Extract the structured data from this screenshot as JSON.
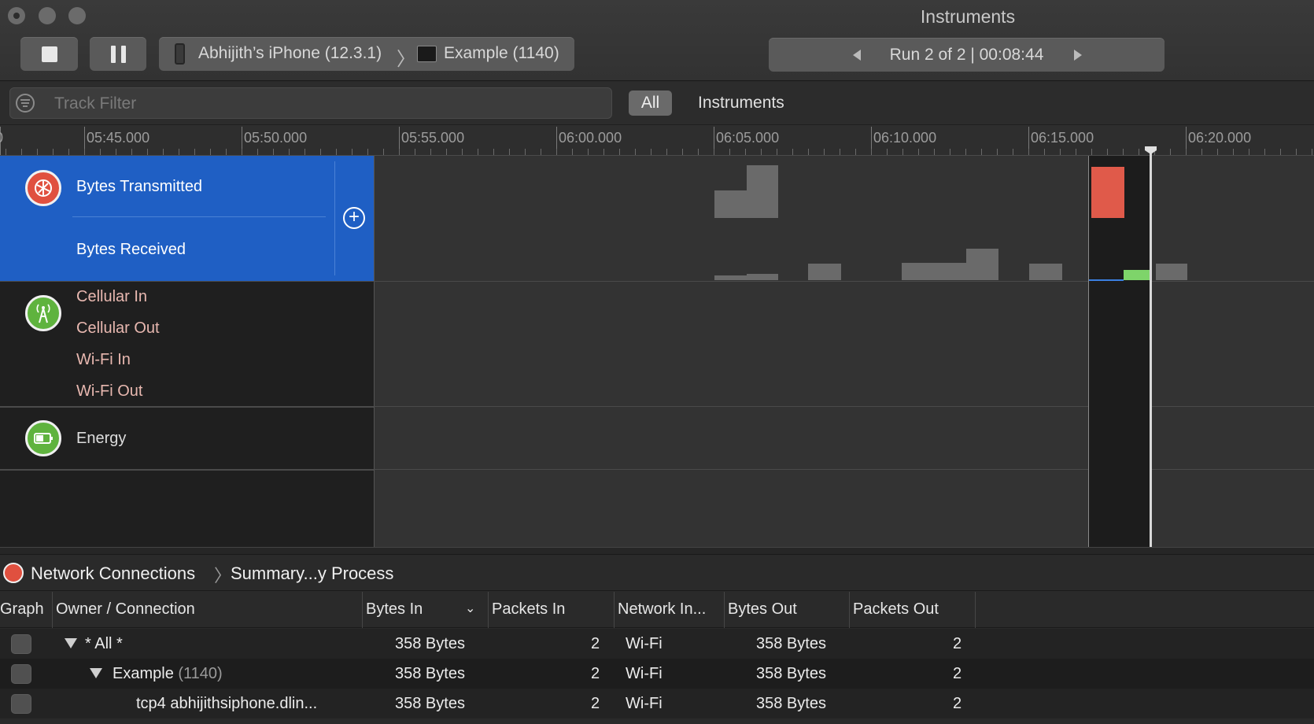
{
  "window": {
    "title": "Instruments"
  },
  "toolbar": {
    "device": "Abhijith’s iPhone (12.3.1)",
    "app": "Example (1140)",
    "run_label": "Run 2 of 2  |  00:08:44"
  },
  "filter": {
    "placeholder": "Track Filter",
    "all_label": "All",
    "instruments_label": "Instruments"
  },
  "ruler": {
    "ticks": [
      "05:45.000",
      "05:50.000",
      "05:55.000",
      "06:00.000",
      "06:05.000",
      "06:10.000",
      "06:15.000",
      "06:20.000"
    ]
  },
  "tracks": {
    "network": {
      "transmitted": "Bytes Transmitted",
      "received": "Bytes Received"
    },
    "connectivity": {
      "cell_in": "Cellular In",
      "cell_out": "Cellular Out",
      "wifi_in": "Wi-Fi In",
      "wifi_out": "Wi-Fi Out"
    },
    "energy": {
      "label": "Energy"
    }
  },
  "detail": {
    "instrument": "Network Connections",
    "view": "Summary...y Process",
    "columns": [
      "Graph",
      "Owner / Connection",
      "Bytes In",
      "Packets In",
      "Network In...",
      "Bytes Out",
      "Packets Out"
    ],
    "rows": [
      {
        "owner": "* All *",
        "pid": "",
        "bytes_in": "358 Bytes",
        "packets_in": "2",
        "network": "Wi-Fi",
        "bytes_out": "358 Bytes",
        "packets_out": "2"
      },
      {
        "owner": "Example",
        "pid": "(1140)",
        "bytes_in": "358 Bytes",
        "packets_in": "2",
        "network": "Wi-Fi",
        "bytes_out": "358 Bytes",
        "packets_out": "2"
      },
      {
        "owner": "tcp4 abhijithsiphone.dlin...",
        "pid": "",
        "bytes_in": "358 Bytes",
        "packets_in": "2",
        "network": "Wi-Fi",
        "bytes_out": "358 Bytes",
        "packets_out": "2"
      }
    ]
  },
  "colors": {
    "selection": "#1f5fc4",
    "network_icon": "#e0503f",
    "connectivity_icon": "#5fb33e",
    "energy_icon": "#5fb33e",
    "transmit_highlight": "#e05a4a",
    "receive_highlight": "#7ed46a"
  }
}
